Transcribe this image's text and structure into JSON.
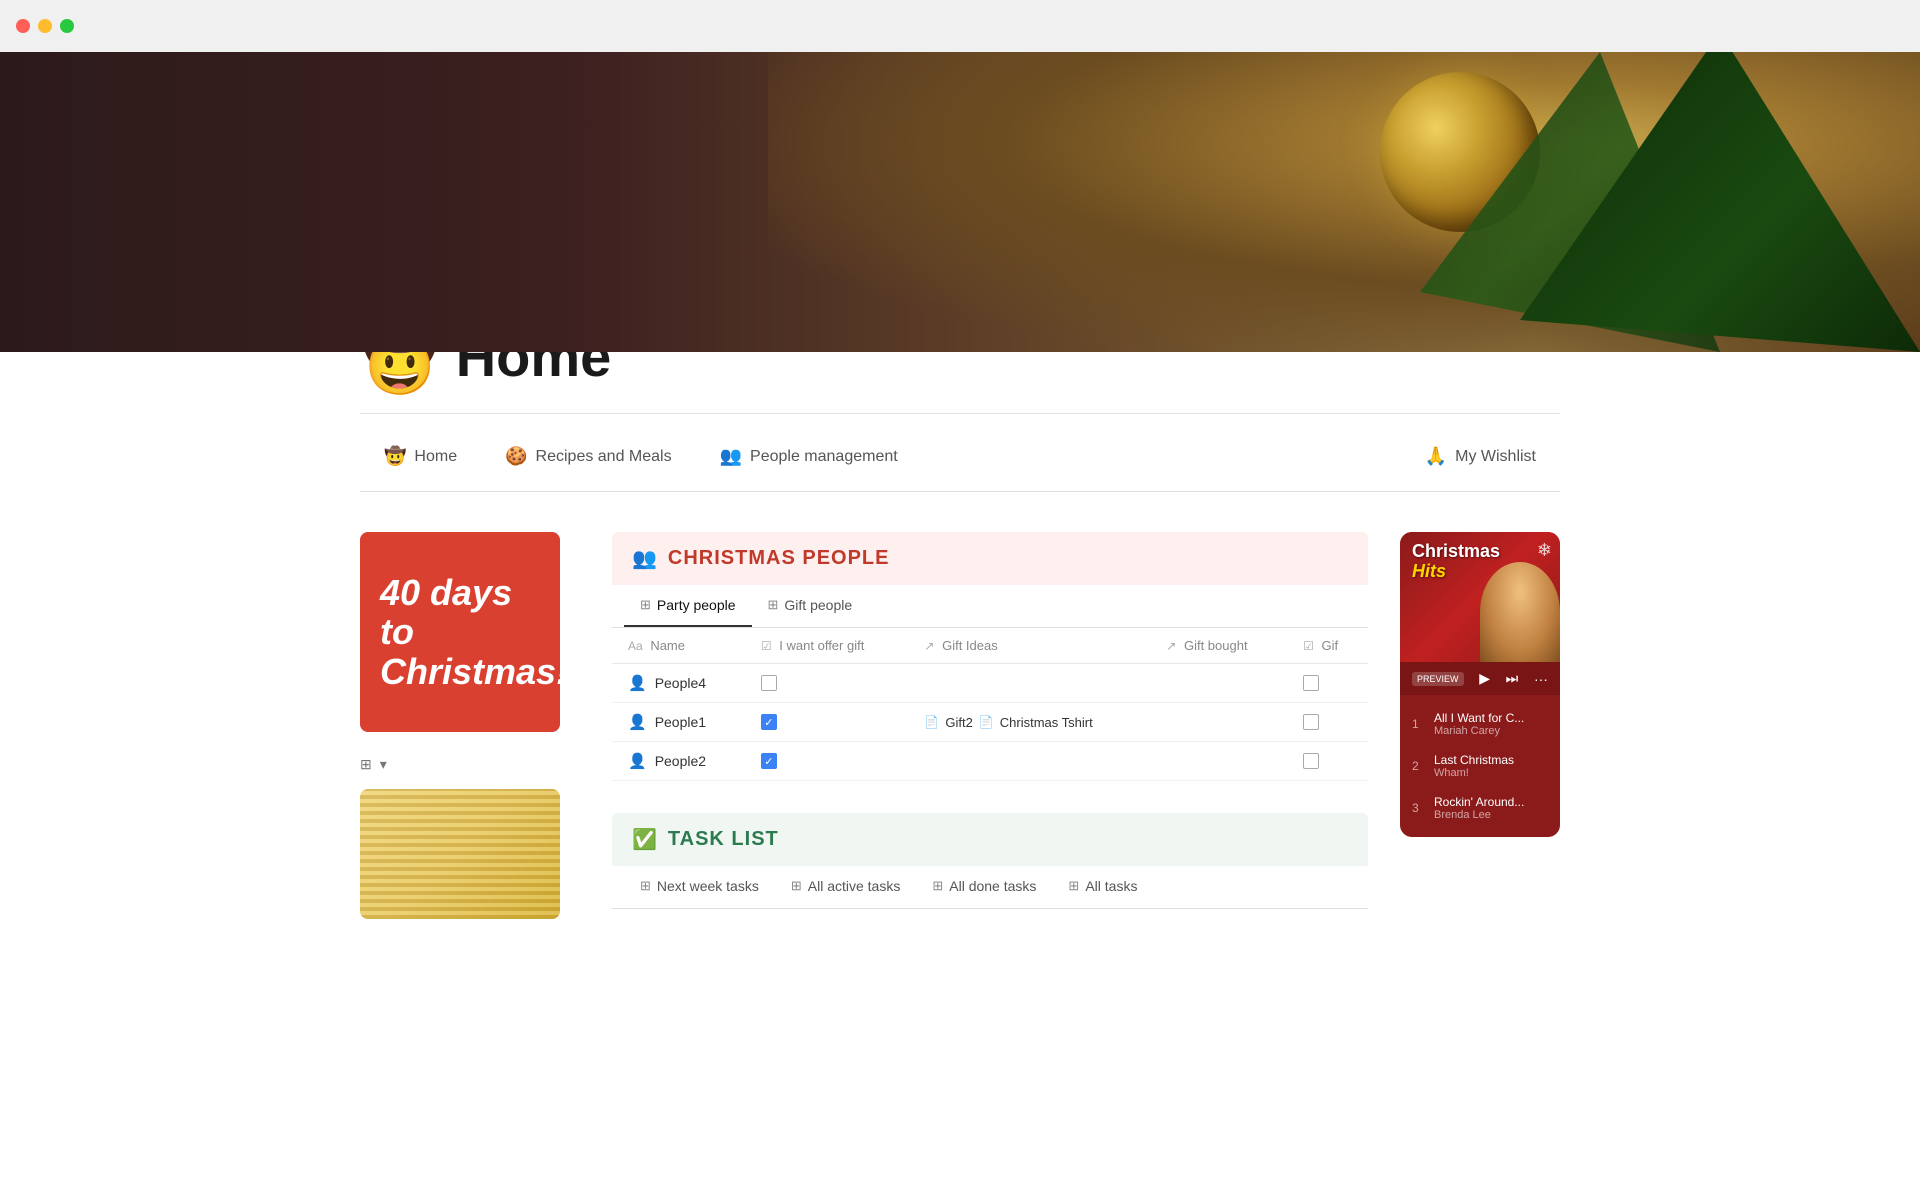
{
  "titlebar": {
    "close_color": "#ff5f57",
    "minimize_color": "#febc2e",
    "maximize_color": "#28c840"
  },
  "hero": {
    "alt": "Christmas ornament and pine tree decoration"
  },
  "page": {
    "emoji": "🤠",
    "title": "Home"
  },
  "nav": {
    "items": [
      {
        "id": "home",
        "emoji": "🤠",
        "label": "Home"
      },
      {
        "id": "recipes",
        "emoji": "🍪",
        "label": "Recipes and Meals"
      },
      {
        "id": "people",
        "emoji": "👥",
        "label": "People management"
      },
      {
        "id": "wishlist",
        "emoji": "🙏",
        "label": "My Wishlist"
      }
    ]
  },
  "countdown": {
    "line1": "40 days to",
    "line2": "Christmas!"
  },
  "view_toggle": {
    "icon": "⊞",
    "arrow": "▾"
  },
  "christmas_people": {
    "section_icon": "👥",
    "section_label": "CHRISTMAS PEOPLE",
    "tabs": [
      {
        "id": "party",
        "label": "Party people",
        "active": true
      },
      {
        "id": "gift",
        "label": "Gift people",
        "active": false
      }
    ],
    "table": {
      "columns": [
        {
          "id": "name",
          "icon": "Aa",
          "label": "Name"
        },
        {
          "id": "want_gift",
          "icon": "☑",
          "label": "I want offer gift"
        },
        {
          "id": "gift_ideas",
          "icon": "↗",
          "label": "Gift Ideas"
        },
        {
          "id": "gift_bought",
          "icon": "↗",
          "label": "Gift bought"
        },
        {
          "id": "gif",
          "icon": "☑",
          "label": "Gif"
        }
      ],
      "rows": [
        {
          "name": "People4",
          "want_gift": false,
          "gift_ideas": [],
          "gift_bought_val": "",
          "gif_checked": false
        },
        {
          "name": "People1",
          "want_gift": true,
          "gift_ideas": [
            "Gift2",
            "Christmas Tshirt"
          ],
          "gift_bought_val": "",
          "gif_checked": false
        },
        {
          "name": "People2",
          "want_gift": true,
          "gift_ideas": [],
          "gift_bought_val": "",
          "gif_checked": false
        }
      ]
    }
  },
  "task_list": {
    "section_icon": "✅",
    "section_label": "TASK LIST",
    "tabs": [
      {
        "id": "next_week",
        "label": "Next week tasks",
        "active": false
      },
      {
        "id": "active",
        "label": "All active tasks",
        "active": false
      },
      {
        "id": "done",
        "label": "All done tasks",
        "active": false
      },
      {
        "id": "all",
        "label": "All tasks",
        "active": false
      }
    ]
  },
  "music": {
    "title_line1": "Christmas",
    "title_line2": "Hits",
    "snowflake": "❄",
    "controls": {
      "preview": "PREVIEW",
      "play": "▶",
      "next": "⏭",
      "more": "···"
    },
    "playlist": [
      {
        "num": "1",
        "song": "All I Want for C...",
        "artist": "Mariah Carey"
      },
      {
        "num": "2",
        "song": "Last Christmas",
        "artist": "Wham!"
      },
      {
        "num": "3",
        "song": "Rockin' Around...",
        "artist": "Brenda Lee"
      }
    ]
  }
}
